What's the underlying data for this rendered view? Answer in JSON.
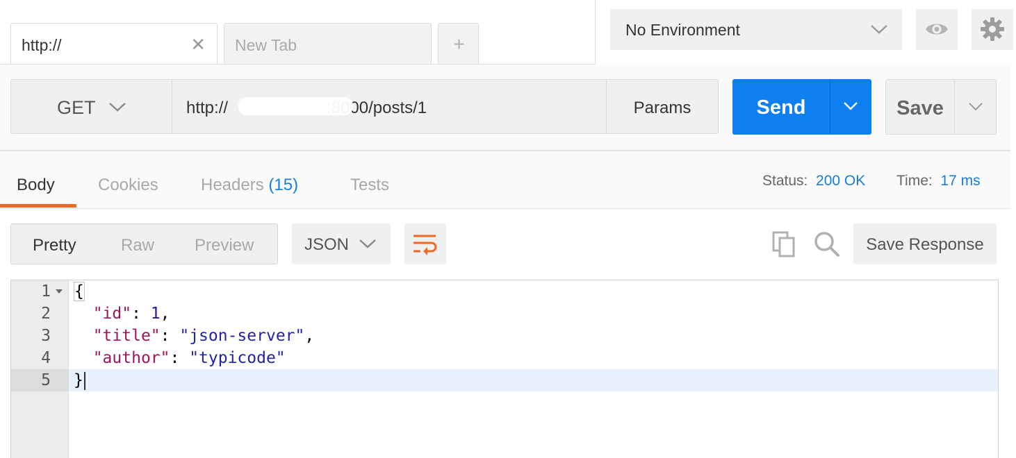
{
  "tabs": {
    "active_label": "http://",
    "inactive_label": "New Tab",
    "add_label": "+",
    "close_glyph": "✕"
  },
  "environment": {
    "selected": "No Environment"
  },
  "icons": {
    "eye": "eye-icon",
    "settings": "gear-icon",
    "copy": "copy-icon",
    "search": "search-icon",
    "wrap": "wrap-lines-icon"
  },
  "request": {
    "method": "GET",
    "url": "http://",
    "url_suffix": ":8000/posts/1",
    "params_label": "Params",
    "send_label": "Send",
    "save_label": "Save"
  },
  "response": {
    "tabs": {
      "body": "Body",
      "cookies": "Cookies",
      "headers": "Headers",
      "headers_count": "(15)",
      "tests": "Tests"
    },
    "status_label": "Status:",
    "status_value": "200 OK",
    "time_label": "Time:",
    "time_value": "17 ms",
    "formats": {
      "pretty": "Pretty",
      "raw": "Raw",
      "preview": "Preview"
    },
    "language": "JSON",
    "save_response_label": "Save Response",
    "body_lines": [
      {
        "num": "1",
        "text": "{"
      },
      {
        "num": "2",
        "key": "\"id\"",
        "sep": ": ",
        "value": "1",
        "trail": ","
      },
      {
        "num": "3",
        "key": "\"title\"",
        "sep": ": ",
        "value": "\"json-server\"",
        "trail": ","
      },
      {
        "num": "4",
        "key": "\"author\"",
        "sep": ": ",
        "value": "\"typicode\"",
        "trail": ""
      },
      {
        "num": "5",
        "text": "}"
      }
    ]
  },
  "colors": {
    "send_blue": "#0d7ff0",
    "active_tab_underline": "#f06a24",
    "status_blue": "#1a7dd6",
    "json_key": "#a0145a",
    "json_string": "#2222aa"
  }
}
